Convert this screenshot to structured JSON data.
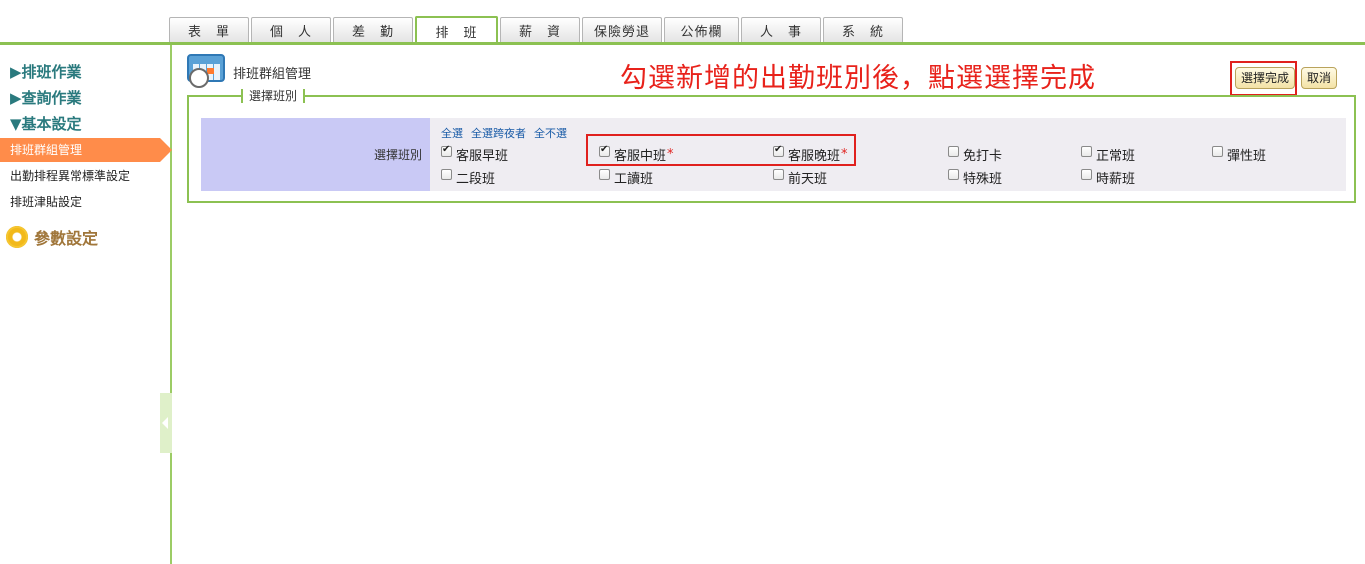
{
  "tabs": [
    {
      "label": "表　單",
      "w": 80,
      "active": false
    },
    {
      "label": "個　人",
      "w": 80,
      "active": false
    },
    {
      "label": "差　勤",
      "w": 80,
      "active": false
    },
    {
      "label": "排　班",
      "w": 83,
      "active": true
    },
    {
      "label": "薪　資",
      "w": 80,
      "active": false
    },
    {
      "label": "保險勞退",
      "w": 80,
      "active": false
    },
    {
      "label": "公佈欄",
      "w": 75,
      "active": false
    },
    {
      "label": "人　事",
      "w": 80,
      "active": false
    },
    {
      "label": "系　統",
      "w": 80,
      "active": false
    }
  ],
  "sidebar": {
    "headings": [
      "▶排班作業",
      "▶查詢作業",
      "▼基本設定"
    ],
    "items": [
      {
        "label": "排班群組管理",
        "active": true
      },
      {
        "label": "出勤排程異常標準設定",
        "active": false
      },
      {
        "label": "排班津貼設定",
        "active": false
      }
    ],
    "param_label": "參數設定"
  },
  "header": {
    "title": "排班群組管理",
    "annotation": "勾選新增的出勤班別後，點選選擇完成",
    "done_label": "選擇完成",
    "cancel_label": "取消"
  },
  "panel": {
    "legend": "選擇班別",
    "row_label": "選擇班別",
    "links": [
      "全選",
      "全選跨夜者",
      "全不選"
    ],
    "options": [
      {
        "label": "客服早班",
        "checked": true,
        "required": false
      },
      {
        "label": "客服中班",
        "checked": true,
        "required": true
      },
      {
        "label": "客服晚班",
        "checked": true,
        "required": true
      },
      {
        "label": "免打卡",
        "checked": false,
        "required": false
      },
      {
        "label": "正常班",
        "checked": false,
        "required": false
      },
      {
        "label": "彈性班",
        "checked": false,
        "required": false
      },
      {
        "label": "二段班",
        "checked": false,
        "required": false
      },
      {
        "label": "工讀班",
        "checked": false,
        "required": false
      },
      {
        "label": "前天班",
        "checked": false,
        "required": false
      },
      {
        "label": "特殊班",
        "checked": false,
        "required": false
      },
      {
        "label": "時薪班",
        "checked": false,
        "required": false
      }
    ]
  }
}
